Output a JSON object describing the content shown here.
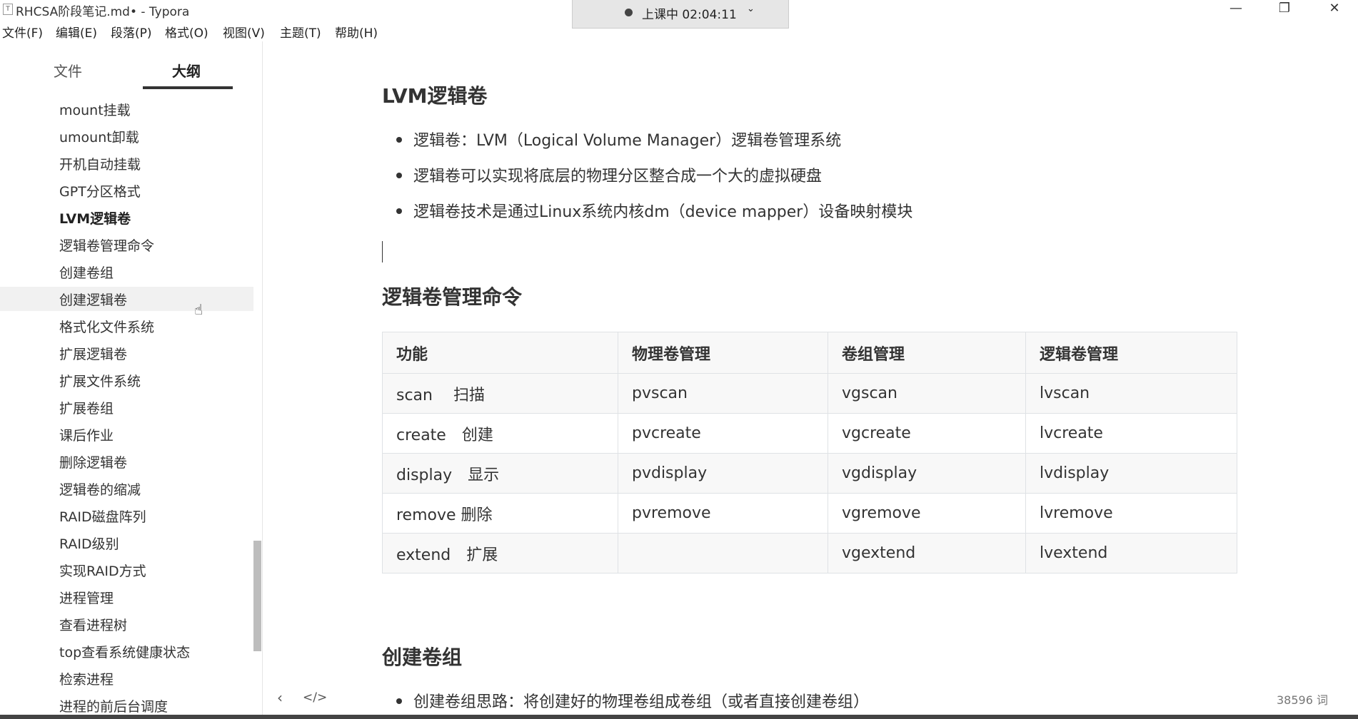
{
  "window": {
    "icon_text": "T",
    "title": "RHCSA阶段笔记.md• - Typora",
    "minimize_glyph": "—",
    "restore_glyph": "❐",
    "close_glyph": "✕"
  },
  "timer": {
    "text": "上课中 02:04:11",
    "chevron": "⌄"
  },
  "menu": [
    "文件(F)",
    "编辑(E)",
    "段落(P)",
    "格式(O)",
    "视图(V)",
    "主题(T)",
    "帮助(H)"
  ],
  "sidebar": {
    "tab_files": "文件",
    "tab_outline": "大纲",
    "items": [
      "mount挂载",
      "umount卸载",
      "开机自动挂载",
      "GPT分区格式",
      "LVM逻辑卷",
      "逻辑卷管理命令",
      "创建卷组",
      "创建逻辑卷",
      "格式化文件系统",
      "扩展逻辑卷",
      "扩展文件系统",
      "扩展卷组",
      "课后作业",
      "删除逻辑卷",
      "逻辑卷的缩减",
      "RAID磁盘阵列",
      "RAID级别",
      "实现RAID方式",
      "进程管理",
      "查看进程树",
      "top查看系统健康状态",
      "检索进程",
      "进程的前后台调度"
    ],
    "active_item": "LVM逻辑卷",
    "hover_item": "创建逻辑卷"
  },
  "doc": {
    "h_lvm": "LVM逻辑卷",
    "lvm_bullets": [
      "逻辑卷：LVM（Logical Volume Manager）逻辑卷管理系统",
      "逻辑卷可以实现将底层的物理分区整合成一个大的虚拟硬盘",
      "逻辑卷技术是通过Linux系统内核dm（device mapper）设备映射模块"
    ],
    "h_commands": "逻辑卷管理命令",
    "table": {
      "headers": [
        "功能",
        "物理卷管理",
        "卷组管理",
        "逻辑卷管理"
      ],
      "rows": [
        [
          "scan　 扫描",
          "pvscan",
          "vgscan",
          "lvscan"
        ],
        [
          "create　创建",
          "pvcreate",
          "vgcreate",
          "lvcreate"
        ],
        [
          "display　显示",
          "pvdisplay",
          "vgdisplay",
          "lvdisplay"
        ],
        [
          "remove 删除",
          "pvremove",
          "vgremove",
          "lvremove"
        ],
        [
          "extend　扩展",
          "",
          "vgextend",
          "lvextend"
        ]
      ]
    },
    "h_create_vg": "创建卷组",
    "create_vg_bullet": "创建卷组思路：将创建好的物理卷组成卷组（或者直接创建卷组）"
  },
  "statusbar": {
    "back_glyph": "‹",
    "source_glyph": "</>",
    "word_count": "38596 词"
  }
}
